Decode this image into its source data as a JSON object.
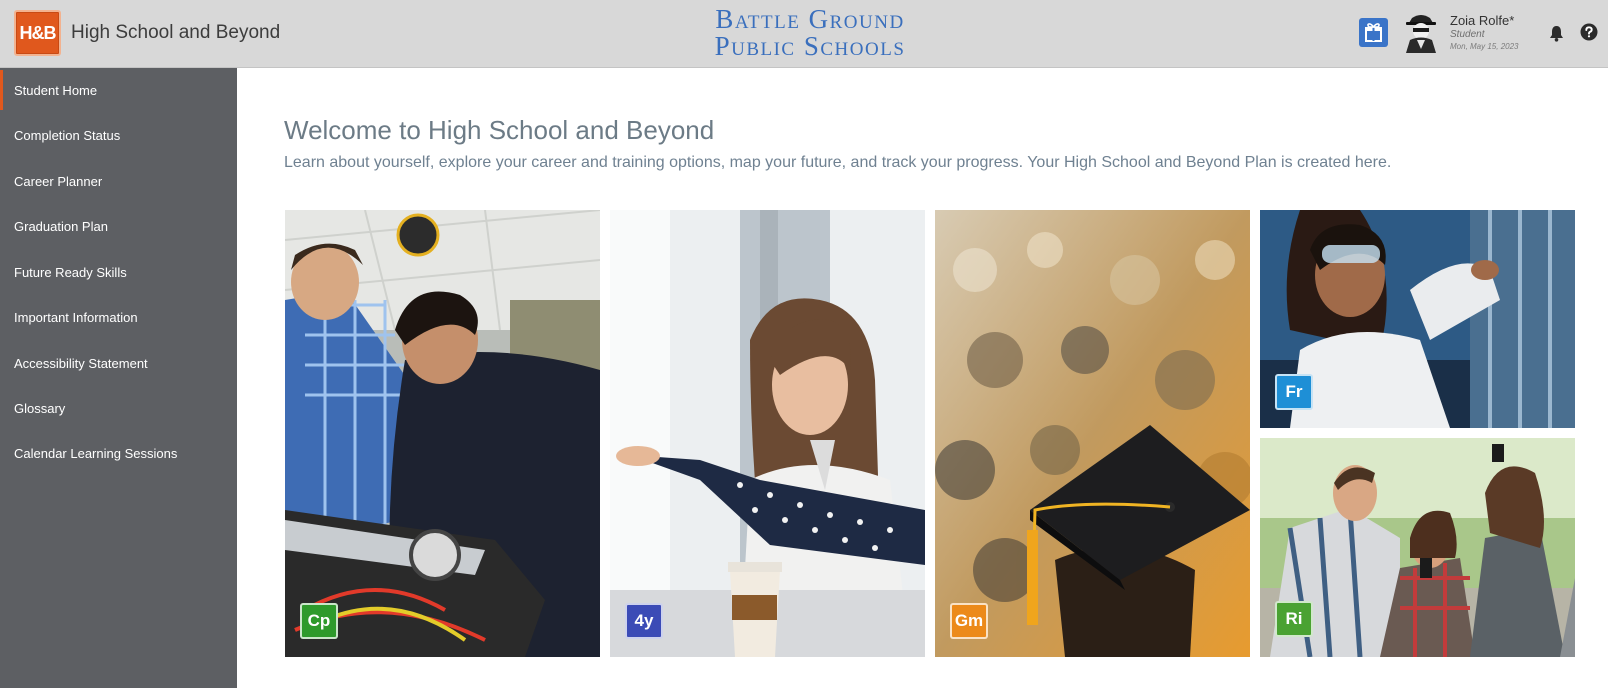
{
  "header": {
    "logo_text": "H&B",
    "app_title": "High School and Beyond",
    "district_line1": "Battle Ground",
    "district_line2": "Public Schools",
    "user": {
      "name": "Zoia Rolfe*",
      "role": "Student",
      "date": "Mon, May 15, 2023"
    },
    "icons": [
      "gift-icon",
      "user-avatar",
      "bell-icon",
      "help-icon"
    ]
  },
  "sidebar": {
    "items": [
      {
        "label": "Student Home",
        "active": true
      },
      {
        "label": "Completion Status"
      },
      {
        "label": "Career Planner"
      },
      {
        "label": "Graduation Plan"
      },
      {
        "label": "Future Ready Skills"
      },
      {
        "label": "Important Information"
      },
      {
        "label": "Accessibility Statement"
      },
      {
        "label": "Glossary"
      },
      {
        "label": "Calendar Learning Sessions"
      }
    ]
  },
  "main": {
    "title": "Welcome to High School and Beyond",
    "subtitle": "Learn about yourself, explore your career and training options, map your future, and track your progress. Your High School and Beyond Plan is created here.",
    "tiles": [
      {
        "badge": "Cp",
        "color": "#2e9a2b"
      },
      {
        "badge": "4y",
        "color": "#3b4bb6"
      },
      {
        "badge": "Gm",
        "color": "#ec8a1a"
      },
      {
        "badge": "Fr",
        "color": "#1e8fd6"
      },
      {
        "badge": "Ri",
        "color": "#4aa232"
      }
    ]
  },
  "colors": {
    "accent": "#e0581d",
    "header_bg": "#d8d8d8",
    "sidebar_bg": "#5d5f63",
    "district_blue": "#3a6fbd"
  }
}
